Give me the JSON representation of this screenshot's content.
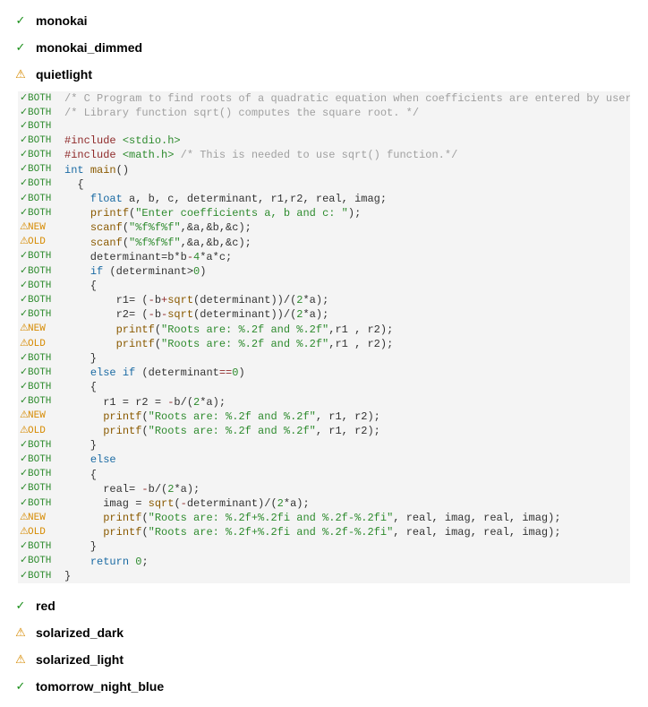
{
  "themes_top": [
    {
      "status": "check",
      "name": "monokai"
    },
    {
      "status": "check",
      "name": "monokai_dimmed"
    },
    {
      "status": "warn",
      "name": "quietlight"
    }
  ],
  "themes_bottom": [
    {
      "status": "check",
      "name": "red"
    },
    {
      "status": "warn",
      "name": "solarized_dark"
    },
    {
      "status": "warn",
      "name": "solarized_light"
    },
    {
      "status": "check",
      "name": "tomorrow_night_blue"
    }
  ],
  "icons": {
    "check": "✓",
    "warn": "⚠"
  },
  "gutter_labels": {
    "both": "BOTH",
    "new": "NEW",
    "old": "OLD"
  },
  "code_lines": [
    {
      "g": "both",
      "tokens": [
        [
          "comment",
          "/* C Program to find roots of a quadratic equation when coefficients are entered by user. */"
        ]
      ]
    },
    {
      "g": "both",
      "tokens": [
        [
          "comment",
          "/* Library function sqrt() computes the square root. */"
        ]
      ]
    },
    {
      "g": "both",
      "tokens": [
        [
          "",
          ""
        ]
      ]
    },
    {
      "g": "both",
      "tokens": [
        [
          "pp",
          "#include "
        ],
        [
          "include",
          "<stdio.h>"
        ]
      ]
    },
    {
      "g": "both",
      "tokens": [
        [
          "pp",
          "#include "
        ],
        [
          "include",
          "<math.h>"
        ],
        [
          "def",
          " "
        ],
        [
          "comment",
          "/* This is needed to use sqrt() function.*/"
        ]
      ]
    },
    {
      "g": "both",
      "tokens": [
        [
          "type",
          "int "
        ],
        [
          "func",
          "main"
        ],
        [
          "def",
          "()"
        ]
      ]
    },
    {
      "g": "both",
      "tokens": [
        [
          "def",
          "  {"
        ]
      ]
    },
    {
      "g": "both",
      "tokens": [
        [
          "def",
          "    "
        ],
        [
          "type",
          "float"
        ],
        [
          "def",
          " a, b, c, determinant, r1,r2, real, imag;"
        ]
      ]
    },
    {
      "g": "both",
      "tokens": [
        [
          "def",
          "    "
        ],
        [
          "func",
          "printf"
        ],
        [
          "def",
          "("
        ],
        [
          "str",
          "\"Enter coefficients a, b and c: \""
        ],
        [
          "def",
          ");"
        ]
      ]
    },
    {
      "g": "new",
      "tokens": [
        [
          "def",
          "    "
        ],
        [
          "func",
          "scanf"
        ],
        [
          "def",
          "("
        ],
        [
          "str",
          "\"%f%f%f\""
        ],
        [
          "def",
          ",&a,&b,&c);"
        ]
      ]
    },
    {
      "g": "old",
      "tokens": [
        [
          "def",
          "    "
        ],
        [
          "func",
          "scanf"
        ],
        [
          "def",
          "("
        ],
        [
          "str",
          "\"%f%f%f\""
        ],
        [
          "def",
          ",&a,&b,&c);"
        ]
      ]
    },
    {
      "g": "both",
      "tokens": [
        [
          "def",
          "    determinant=b*b"
        ],
        [
          "op",
          "-"
        ],
        [
          "num",
          "4"
        ],
        [
          "def",
          "*a*c;"
        ]
      ]
    },
    {
      "g": "both",
      "tokens": [
        [
          "def",
          "    "
        ],
        [
          "kw",
          "if"
        ],
        [
          "def",
          " (determinant>"
        ],
        [
          "num",
          "0"
        ],
        [
          "def",
          ")"
        ]
      ]
    },
    {
      "g": "both",
      "tokens": [
        [
          "def",
          "    {"
        ]
      ]
    },
    {
      "g": "both",
      "tokens": [
        [
          "def",
          "        r1= ("
        ],
        [
          "op",
          "-"
        ],
        [
          "def",
          "b"
        ],
        [
          "op",
          "+"
        ],
        [
          "func",
          "sqrt"
        ],
        [
          "def",
          "(determinant))/("
        ],
        [
          "num",
          "2"
        ],
        [
          "def",
          "*a);"
        ]
      ]
    },
    {
      "g": "both",
      "tokens": [
        [
          "def",
          "        r2= ("
        ],
        [
          "op",
          "-"
        ],
        [
          "def",
          "b"
        ],
        [
          "op",
          "-"
        ],
        [
          "func",
          "sqrt"
        ],
        [
          "def",
          "(determinant))/("
        ],
        [
          "num",
          "2"
        ],
        [
          "def",
          "*a);"
        ]
      ]
    },
    {
      "g": "new",
      "tokens": [
        [
          "def",
          "        "
        ],
        [
          "func",
          "printf"
        ],
        [
          "def",
          "("
        ],
        [
          "str",
          "\"Roots are: %.2f and %.2f\""
        ],
        [
          "def",
          ",r1 , r2);"
        ]
      ]
    },
    {
      "g": "old",
      "tokens": [
        [
          "def",
          "        "
        ],
        [
          "func",
          "printf"
        ],
        [
          "def",
          "("
        ],
        [
          "str",
          "\"Roots are: %.2f and %.2f\""
        ],
        [
          "def",
          ",r1 , r2);"
        ]
      ]
    },
    {
      "g": "both",
      "tokens": [
        [
          "def",
          "    }"
        ]
      ]
    },
    {
      "g": "both",
      "tokens": [
        [
          "def",
          "    "
        ],
        [
          "kw",
          "else if"
        ],
        [
          "def",
          " (determinant"
        ],
        [
          "op",
          "=="
        ],
        [
          "num",
          "0"
        ],
        [
          "def",
          ")"
        ]
      ]
    },
    {
      "g": "both",
      "tokens": [
        [
          "def",
          "    {"
        ]
      ]
    },
    {
      "g": "both",
      "tokens": [
        [
          "def",
          "      r1 = r2 = "
        ],
        [
          "op",
          "-"
        ],
        [
          "def",
          "b/("
        ],
        [
          "num",
          "2"
        ],
        [
          "def",
          "*a);"
        ]
      ]
    },
    {
      "g": "new",
      "tokens": [
        [
          "def",
          "      "
        ],
        [
          "func",
          "printf"
        ],
        [
          "def",
          "("
        ],
        [
          "str",
          "\"Roots are: %.2f and %.2f\""
        ],
        [
          "def",
          ", r1, r2);"
        ]
      ]
    },
    {
      "g": "old",
      "tokens": [
        [
          "def",
          "      "
        ],
        [
          "func",
          "printf"
        ],
        [
          "def",
          "("
        ],
        [
          "str",
          "\"Roots are: %.2f and %.2f\""
        ],
        [
          "def",
          ", r1, r2);"
        ]
      ]
    },
    {
      "g": "both",
      "tokens": [
        [
          "def",
          "    }"
        ]
      ]
    },
    {
      "g": "both",
      "tokens": [
        [
          "def",
          "    "
        ],
        [
          "kw",
          "else"
        ]
      ]
    },
    {
      "g": "both",
      "tokens": [
        [
          "def",
          "    {"
        ]
      ]
    },
    {
      "g": "both",
      "tokens": [
        [
          "def",
          "      real= "
        ],
        [
          "op",
          "-"
        ],
        [
          "def",
          "b/("
        ],
        [
          "num",
          "2"
        ],
        [
          "def",
          "*a);"
        ]
      ]
    },
    {
      "g": "both",
      "tokens": [
        [
          "def",
          "      imag = "
        ],
        [
          "func",
          "sqrt"
        ],
        [
          "def",
          "("
        ],
        [
          "op",
          "-"
        ],
        [
          "def",
          "determinant)/("
        ],
        [
          "num",
          "2"
        ],
        [
          "def",
          "*a);"
        ]
      ]
    },
    {
      "g": "new",
      "tokens": [
        [
          "def",
          "      "
        ],
        [
          "func",
          "printf"
        ],
        [
          "def",
          "("
        ],
        [
          "str",
          "\"Roots are: %.2f+%.2fi and %.2f-%.2fi\""
        ],
        [
          "def",
          ", real, imag, real, imag);"
        ]
      ]
    },
    {
      "g": "old",
      "tokens": [
        [
          "def",
          "      "
        ],
        [
          "func",
          "printf"
        ],
        [
          "def",
          "("
        ],
        [
          "str",
          "\"Roots are: %.2f+%.2fi and %.2f-%.2fi\""
        ],
        [
          "def",
          ", real, imag, real, imag);"
        ]
      ]
    },
    {
      "g": "both",
      "tokens": [
        [
          "def",
          "    }"
        ]
      ]
    },
    {
      "g": "both",
      "tokens": [
        [
          "def",
          "    "
        ],
        [
          "kw",
          "return"
        ],
        [
          "def",
          " "
        ],
        [
          "num",
          "0"
        ],
        [
          "def",
          ";"
        ]
      ]
    },
    {
      "g": "both",
      "tokens": [
        [
          "def",
          "}"
        ]
      ]
    }
  ]
}
